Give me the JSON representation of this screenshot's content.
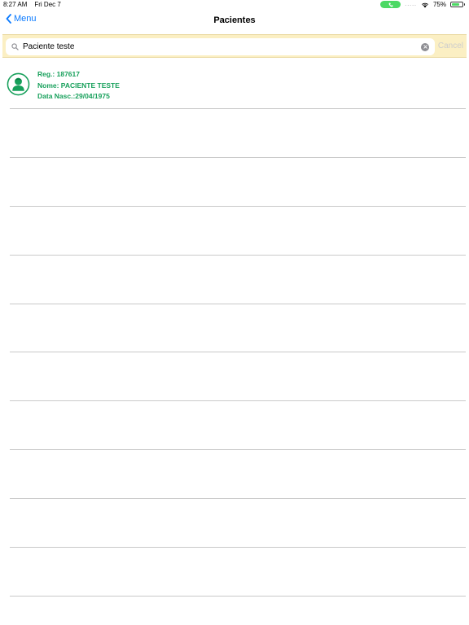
{
  "status_bar": {
    "time": "8:27 AM",
    "date": "Fri Dec 7",
    "signal": ".....",
    "battery": "75%",
    "battery_level": 0.75
  },
  "nav": {
    "back_label": "Menu",
    "title": "Pacientes"
  },
  "search": {
    "value": "Paciente teste",
    "cancel_label": "Cancel"
  },
  "patients": [
    {
      "reg": "Reg.: 187617",
      "name": "Nome: PACIENTE TESTE",
      "birth": "Data Nasc.:29/04/1975"
    }
  ],
  "colors": {
    "accent": "#0a7aff",
    "patient_text": "#17a05b",
    "search_bar_bg": "#fbefc3",
    "call_pill": "#4cd964"
  }
}
